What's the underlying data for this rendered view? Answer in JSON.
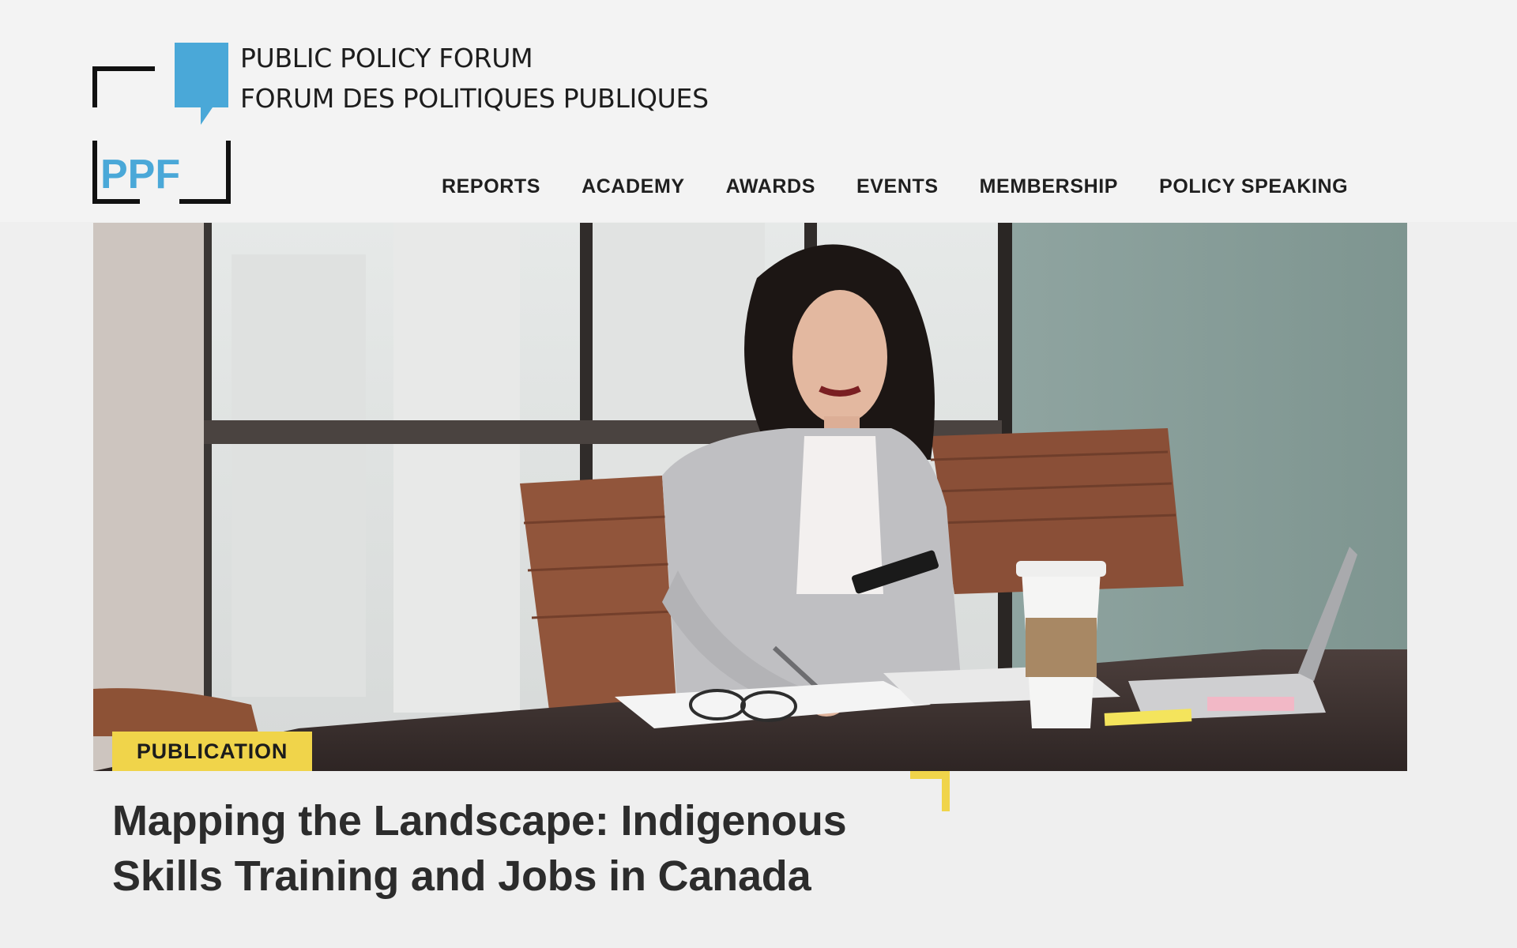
{
  "brand": {
    "name_en": "PUBLIC POLICY FORUM",
    "name_fr": "FORUM DES POLITIQUES PUBLIQUES",
    "logo_text": "PPF",
    "accent_color": "#4aa8d8"
  },
  "nav": {
    "items": [
      {
        "label": "REPORTS"
      },
      {
        "label": "ACADEMY"
      },
      {
        "label": "AWARDS"
      },
      {
        "label": "EVENTS"
      },
      {
        "label": "MEMBERSHIP"
      },
      {
        "label": "POLICY SPEAKING"
      }
    ]
  },
  "feature": {
    "badge": "PUBLICATION",
    "badge_color": "#f0d44a",
    "title_line1": "Mapping the Landscape: Indigenous",
    "title_line2": "Skills Training and Jobs in Canada"
  }
}
